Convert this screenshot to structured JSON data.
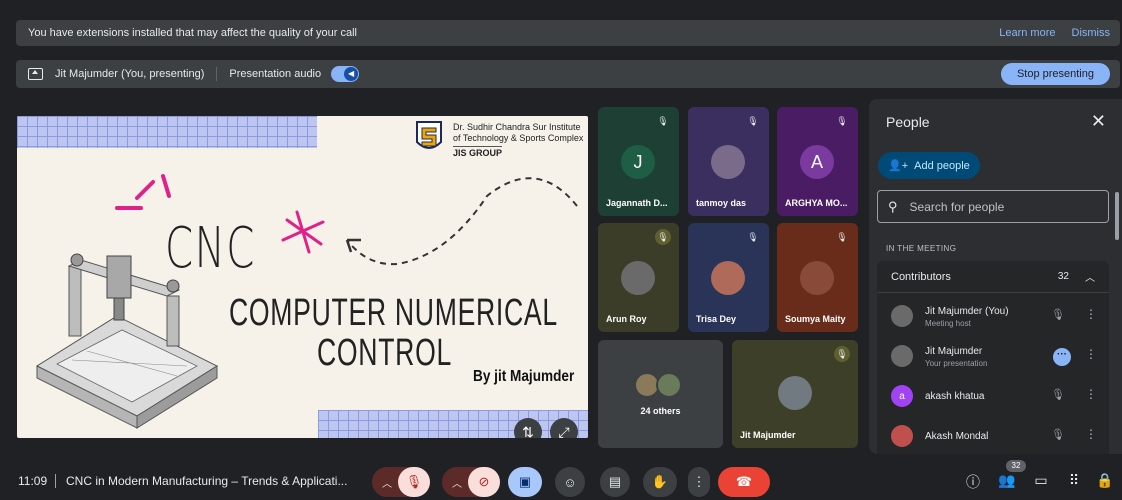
{
  "banner": {
    "message": "You have extensions installed that may affect the quality of your call",
    "learn_more": "Learn more",
    "dismiss": "Dismiss"
  },
  "presenting": {
    "presenter_label": "Jit Majumder (You, presenting)",
    "audio_label": "Presentation audio",
    "audio_enabled": true,
    "stop_label": "Stop presenting"
  },
  "slide": {
    "institute_line1": "Dr. Sudhir Chandra Sur Institute",
    "institute_line2": "of Technology & Sports Complex",
    "group": "JIS GROUP",
    "title": "CNC",
    "subtitle_line1": "COMPUTER NUMERICAL",
    "subtitle_line2": "CONTROL",
    "byline": "By jit Majumder"
  },
  "tiles": [
    {
      "name": "Jagannath D...",
      "initial": "J",
      "bg": "#1e3f33",
      "avatar_color": "#1e5e45",
      "muted": true
    },
    {
      "name": "tanmoy das",
      "initial": "",
      "bg": "#3a2f5e",
      "avatar_color": "#7a6b8a",
      "muted": true
    },
    {
      "name": "ARGHYA MO...",
      "initial": "A",
      "bg": "#4a1c64",
      "avatar_color": "#7b3aa0",
      "muted": true
    },
    {
      "name": "Arun Roy",
      "initial": "",
      "bg": "#3b3d28",
      "avatar_color": "#6a6a6a",
      "muted": true
    },
    {
      "name": "Trisa Dey",
      "initial": "",
      "bg": "#2a3358",
      "avatar_color": "#b06a5a",
      "muted": true
    },
    {
      "name": "Soumya Maity",
      "initial": "",
      "bg": "#6a2c1a",
      "avatar_color": "#8a4a3a",
      "muted": true
    },
    {
      "name": "24 others",
      "initial": "",
      "bg": "#3c4043",
      "avatar_color": "#8a7a5a",
      "muted": false
    },
    {
      "name": "Jit Majumder",
      "initial": "",
      "bg": "#3e3f29",
      "avatar_color": "#707a80",
      "muted": true
    }
  ],
  "people_panel": {
    "title": "People",
    "add_people": "Add people",
    "search_placeholder": "Search for people",
    "in_meeting": "IN THE MEETING",
    "contributors_label": "Contributors",
    "contributors_count": "32",
    "people": [
      {
        "name": "Jit Majumder (You)",
        "sub": "Meeting host",
        "initial": "",
        "color": "#6a6a6a",
        "state": "muted"
      },
      {
        "name": "Jit Majumder",
        "sub": "Your presentation",
        "initial": "",
        "color": "#6a6a6a",
        "state": "presenting"
      },
      {
        "name": "akash khatua",
        "sub": "",
        "initial": "a",
        "color": "#a142f4",
        "state": "muted"
      },
      {
        "name": "Akash Mondal",
        "sub": "",
        "initial": "",
        "color": "#c0504d",
        "state": "muted"
      }
    ]
  },
  "bottom_bar": {
    "time": "11:09",
    "meeting_title": "CNC in Modern Manufacturing – Trends & Applicati...",
    "people_badge": "32"
  },
  "colors": {
    "background": "#202124",
    "accent": "#8ab4f8",
    "end_call": "#ea4335"
  }
}
